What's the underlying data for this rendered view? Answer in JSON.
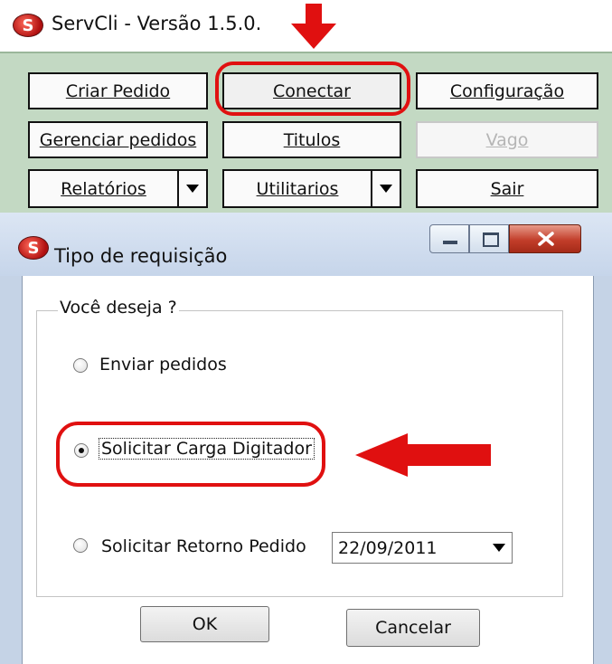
{
  "main_window": {
    "title": "ServCli - Versão 1.5.0.",
    "icon": "servcli-app-icon",
    "app_icon_letter": "S",
    "buttons": {
      "criar_pedido": "Criar Pedido",
      "conectar": "Conectar",
      "configuracao": "Configuração",
      "gerenciar_pedidos": "Gerenciar pedidos",
      "titulos": "Titulos",
      "vago": "Vago",
      "relatorios": "Relatórios",
      "utilitarios": "Utilitarios",
      "sair": "Sair"
    },
    "highlight_color": "#e01010"
  },
  "dialog": {
    "title": "Tipo de requisição",
    "icon": "servcli-app-icon",
    "app_icon_letter": "S",
    "group_label": "Você deseja ?",
    "options": {
      "enviar_pedidos": "Enviar pedidos",
      "solicitar_carga_digitador": "Solicitar Carga Digitador",
      "solicitar_retorno_pedido": "Solicitar Retorno Pedido"
    },
    "selected_option": "solicitar_carga_digitador",
    "date_value": "22/09/2011",
    "ok_label": "OK",
    "cancel_label": "Cancelar"
  },
  "colors": {
    "main_body_bg": "#c3d9c3",
    "dialog_frame": "#c5d3e6",
    "annotation_red": "#e01010"
  }
}
